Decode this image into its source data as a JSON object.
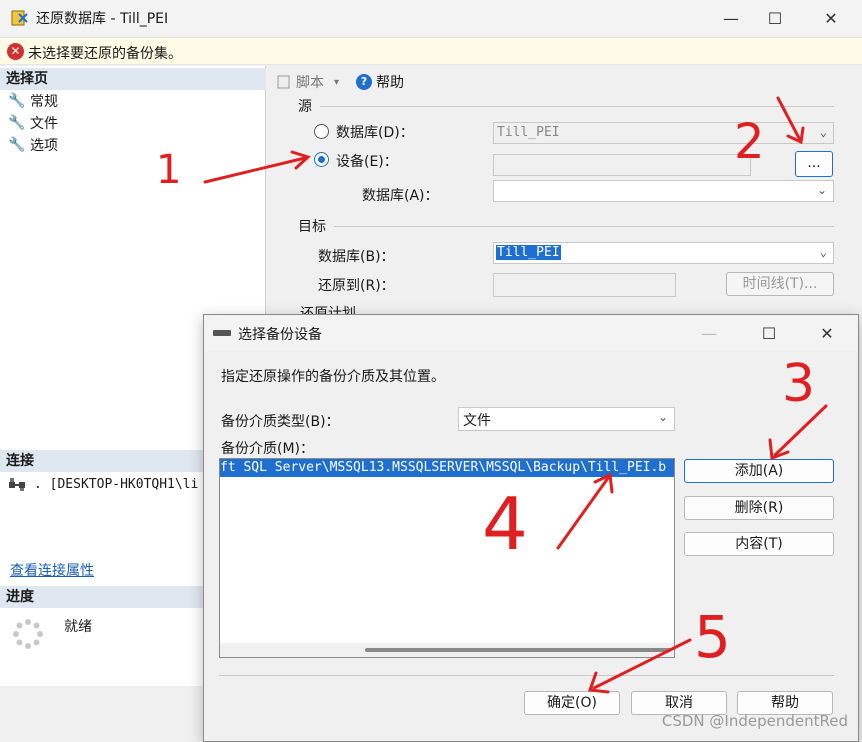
{
  "window": {
    "title": "还原数据库 - Till_PEI",
    "minimize": "—",
    "maximize": "☐",
    "close": "✕"
  },
  "error_bar": {
    "text": "未选择要还原的备份集。"
  },
  "left": {
    "select_page_header": "选择页",
    "items": [
      {
        "label": "常规"
      },
      {
        "label": "文件"
      },
      {
        "label": "选项"
      }
    ],
    "connection_header": "连接",
    "connection_text": ". [DESKTOP-HK0TQH1\\li",
    "connection_link": "查看连接属性",
    "progress_header": "进度",
    "progress_status": "就绪"
  },
  "toolbar": {
    "script": "脚本",
    "help": "帮助"
  },
  "source": {
    "label": "源",
    "database_label": "数据库(D)：",
    "database_value": "Till_PEI",
    "device_label": "设备(E)：",
    "device_value": "",
    "browse_button": "...",
    "device_database_label": "数据库(A)：",
    "device_database_value": ""
  },
  "destination": {
    "label": "目标",
    "database_label": "数据库(B)：",
    "database_value": "Till_PEI",
    "restore_to_label": "还原到(R)：",
    "restore_to_value": "",
    "timeline_button": "时间线(T)..."
  },
  "restore_plan_label": "还原计划",
  "dialog": {
    "title": "选择备份设备",
    "minimize": "—",
    "maximize": "☐",
    "close": "✕",
    "description": "指定还原操作的备份介质及其位置。",
    "media_type_label": "备份介质类型(B)：",
    "media_type_value": "文件",
    "media_label": "备份介质(M)：",
    "media_item": "ft SQL Server\\MSSQL13.MSSQLSERVER\\MSSQL\\Backup\\Till_PEI.b",
    "add_button": "添加(A)",
    "remove_button": "删除(R)",
    "contents_button": "内容(T)",
    "ok_button": "确定(O)",
    "cancel_button": "取消",
    "help_button": "帮助"
  },
  "annotations": {
    "a1": "1",
    "a2": "2",
    "a3": "3",
    "a4": "4",
    "a5": "5"
  },
  "watermark": "CSDN @IndependentRed",
  "colors": {
    "accent": "#1e6fd0",
    "annotation": "#e02020",
    "error": "#d03030"
  }
}
